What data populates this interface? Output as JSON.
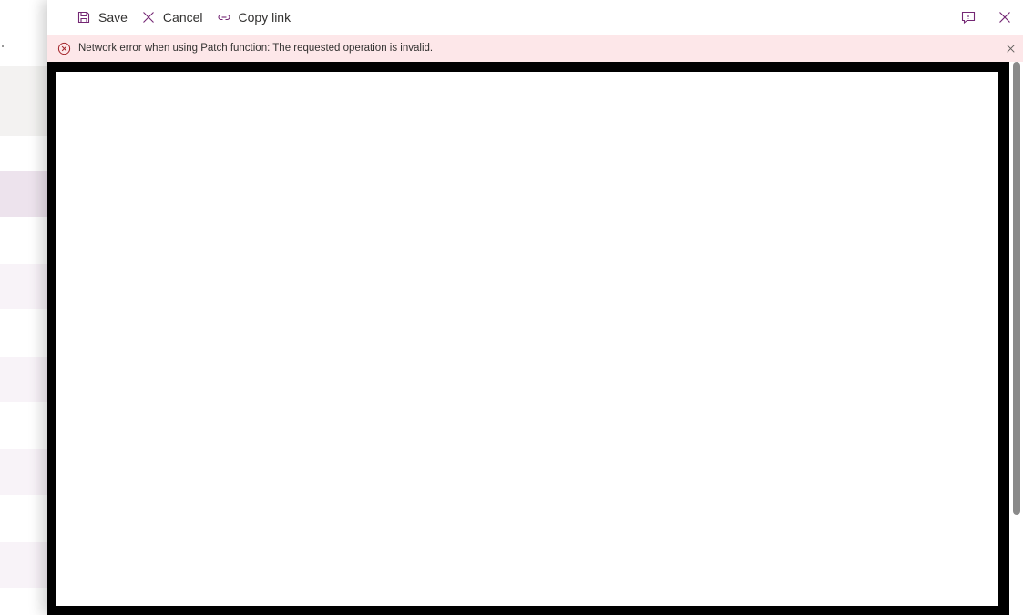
{
  "toolbar": {
    "save_label": "Save",
    "cancel_label": "Cancel",
    "copy_link_label": "Copy link"
  },
  "icons": {
    "save": "save-icon",
    "cancel": "close-icon",
    "copy_link": "link-icon",
    "feedback": "comment-icon",
    "close_panel": "close-icon"
  },
  "error_bar": {
    "message": "Network error when using Patch function: The requested operation is invalid."
  },
  "colors": {
    "accent": "#742774",
    "error_background": "#fde7e9",
    "error_icon": "#a4262c"
  }
}
